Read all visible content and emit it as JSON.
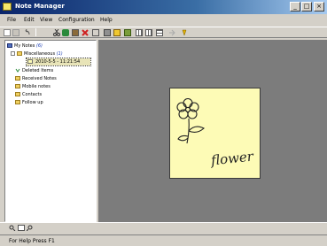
{
  "window": {
    "title": "Note Manager"
  },
  "menu": [
    "File",
    "Edit",
    "View",
    "Configuration",
    "Help"
  ],
  "tree": {
    "root": {
      "label": "My Notes",
      "count": "(6)"
    },
    "misc": {
      "label": "Miscellaneous",
      "count": "(1)"
    },
    "note_item": "2010-5-5 - 11:21:54",
    "deleted": "Deleted Items",
    "received": "Received Notes",
    "mobile": "Mobile notes",
    "contacts": "Contacts",
    "followup": "Follow up"
  },
  "note": {
    "text": "flower",
    "background": "#fdfbb6"
  },
  "status": {
    "text": "For Help Press F1"
  },
  "icons": [
    "minimize-icon",
    "maximize-icon",
    "close-icon",
    "new-note-icon",
    "cut-icon",
    "copy-icon",
    "paste-icon",
    "delete-icon",
    "print-icon",
    "folder-icon",
    "help-icon"
  ]
}
